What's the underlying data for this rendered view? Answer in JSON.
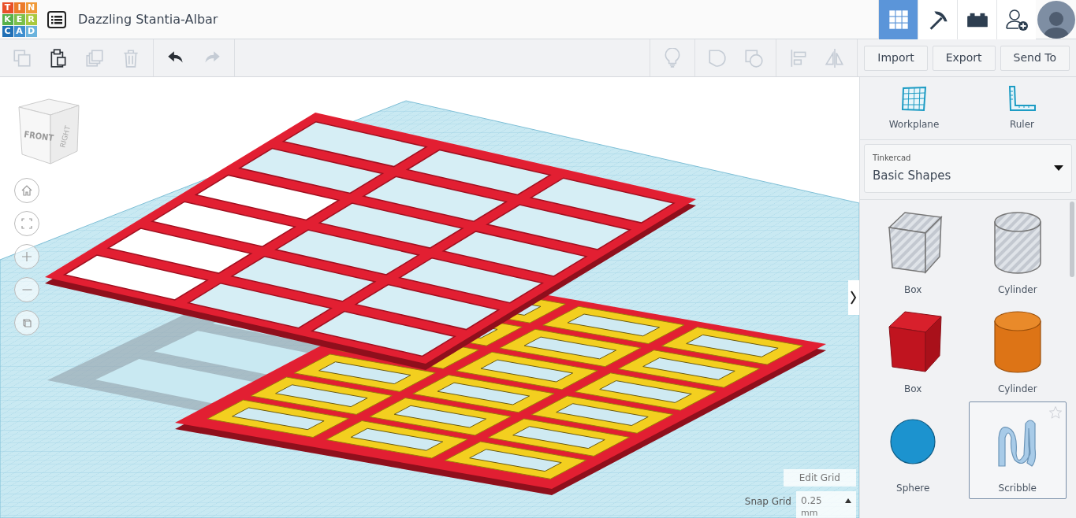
{
  "app": {
    "logo_letters": [
      "T",
      "I",
      "N",
      "K",
      "E",
      "R",
      "C",
      "A",
      "D"
    ],
    "title": "Dazzling Stantia-Albar"
  },
  "header_tabs": [
    {
      "kind": "grid",
      "selected": true
    },
    {
      "kind": "pickaxe",
      "selected": false
    },
    {
      "kind": "bricks",
      "selected": false
    }
  ],
  "toolbar": {
    "edit_tools": [
      {
        "kind": "copy",
        "disabled": true
      },
      {
        "kind": "paste",
        "disabled": false
      },
      {
        "kind": "duplicate",
        "disabled": true
      },
      {
        "kind": "delete",
        "disabled": true
      }
    ],
    "history": [
      {
        "kind": "undo",
        "disabled": false
      },
      {
        "kind": "redo",
        "disabled": true
      }
    ],
    "shape_tools": [
      {
        "kind": "light",
        "disabled": true
      },
      {
        "kind": "group",
        "disabled": true
      },
      {
        "kind": "ungroup",
        "disabled": true
      },
      {
        "kind": "align",
        "disabled": true
      },
      {
        "kind": "mirror",
        "disabled": true
      }
    ],
    "buttons": [
      "Import",
      "Export",
      "Send To"
    ]
  },
  "view_cube": {
    "faces": [
      "FRONT",
      "RIGHT"
    ]
  },
  "view_controls": [
    {
      "kind": "home"
    },
    {
      "kind": "fit"
    },
    {
      "kind": "zoom-in"
    },
    {
      "kind": "zoom-out"
    },
    {
      "kind": "ortho"
    }
  ],
  "panel": {
    "tools": [
      {
        "kind": "workplane",
        "label": "Workplane"
      },
      {
        "kind": "ruler",
        "label": "Ruler"
      }
    ],
    "library": {
      "source": "Tinkercad",
      "category": "Basic Shapes"
    },
    "shapes": [
      {
        "kind": "box-hole",
        "label": "Box",
        "selected": false
      },
      {
        "kind": "cylinder-hole",
        "label": "Cylinder",
        "selected": false
      },
      {
        "kind": "box",
        "label": "Box",
        "selected": false
      },
      {
        "kind": "cylinder",
        "label": "Cylinder",
        "selected": false
      },
      {
        "kind": "sphere",
        "label": "Sphere",
        "selected": false
      },
      {
        "kind": "scribble",
        "label": "Scribble",
        "selected": true
      }
    ]
  },
  "grid": {
    "edit_button": "Edit Grid",
    "snap_label": "Snap Grid",
    "snap_value": "0.25",
    "snap_unit": "mm"
  }
}
